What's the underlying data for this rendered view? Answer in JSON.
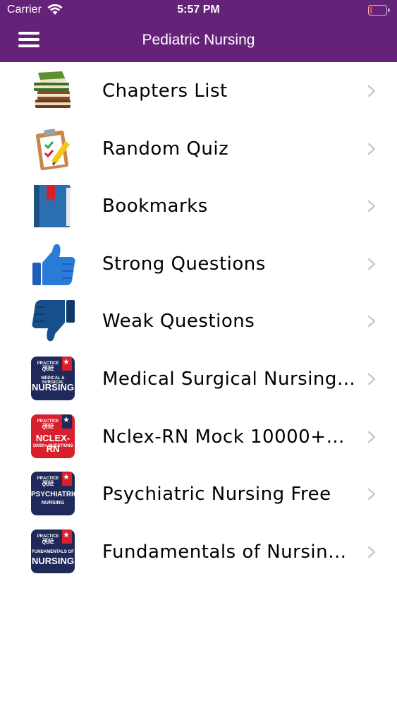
{
  "status_bar": {
    "carrier": "Carrier",
    "time": "5:57 PM"
  },
  "header": {
    "title": "Pediatric Nursing",
    "menu_icon": "hamburger-menu-icon"
  },
  "colors": {
    "header_bg": "#652279",
    "chevron": "#c7c7cc",
    "badge_navy": "#1f2a5a",
    "badge_red": "#d8202c"
  },
  "menu": {
    "items": [
      {
        "label": "Chapters List",
        "icon": "books-stack-icon"
      },
      {
        "label": "Random Quiz",
        "icon": "clipboard-pencil-icon"
      },
      {
        "label": "Bookmarks",
        "icon": "bookmark-book-icon"
      },
      {
        "label": "Strong Questions",
        "icon": "thumbs-up-icon"
      },
      {
        "label": "Weak Questions",
        "icon": "thumbs-down-icon"
      },
      {
        "label": "Medical Surgical Nursing…",
        "icon": "med-surg-nursing-app-icon",
        "badge": {
          "line1": "PRACTICE TEST",
          "line2": "QUIZ",
          "line3": "MEDICAL & SURGICAL",
          "line4": "NURSING"
        }
      },
      {
        "label": "Nclex-RN Mock 10000+…",
        "icon": "nclex-rn-app-icon",
        "badge": {
          "line1": "PRACTICE TEST",
          "line2": "QUIZ",
          "line3": "NCLEX-RN",
          "line4": "10000+ QUESTIONS"
        }
      },
      {
        "label": "Psychiatric Nursing Free",
        "icon": "psychiatric-nursing-app-icon",
        "badge": {
          "line1": "PRACTICE TEST",
          "line2": "QUIZ",
          "line3": "PSYCHIATRIC",
          "line4": "NURSING"
        }
      },
      {
        "label": "Fundamentals of Nursing…",
        "icon": "fundamentals-nursing-app-icon",
        "badge": {
          "line1": "PRACTICE TEST",
          "line2": "QUIZ",
          "line3": "FUNDAMENTALS OF",
          "line4": "NURSING"
        }
      }
    ]
  }
}
